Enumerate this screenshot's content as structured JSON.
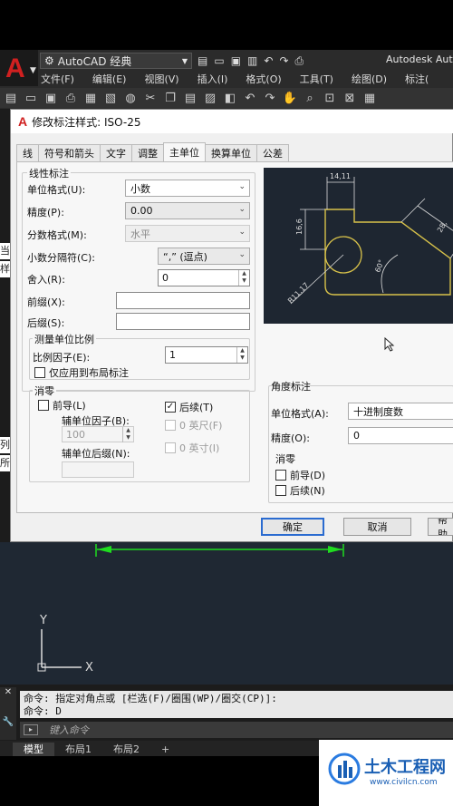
{
  "app": {
    "workspace": "AutoCAD 经典",
    "title": "Autodesk Aut",
    "menu": [
      "文件(F)",
      "编辑(E)",
      "视图(V)",
      "插入(I)",
      "格式(O)",
      "工具(T)",
      "绘图(D)",
      "标注("
    ],
    "side_fragments": [
      "当",
      "样",
      "列",
      "所"
    ]
  },
  "dialog": {
    "title": "修改标注样式: ISO-25",
    "tabs": [
      "线",
      "符号和箭头",
      "文字",
      "调整",
      "主单位",
      "换算单位",
      "公差"
    ],
    "active_tab": "主单位",
    "linear": {
      "group": "线性标注",
      "unit_format_label": "单位格式(U):",
      "unit_format_value": "小数",
      "precision_label": "精度(P):",
      "precision_value": "0.00",
      "fraction_format_label": "分数格式(M):",
      "fraction_format_value": "水平",
      "decimal_sep_label": "小数分隔符(C):",
      "decimal_sep_value": "“,” (逗点)",
      "round_off_label": "舍入(R):",
      "round_off_value": "0",
      "prefix_label": "前缀(X):",
      "prefix_value": "",
      "suffix_label": "后缀(S):",
      "suffix_value": ""
    },
    "scale": {
      "group": "测量单位比例",
      "factor_label": "比例因子(E):",
      "factor_value": "1",
      "layout_only_label": "仅应用到布局标注"
    },
    "zero_suppress": {
      "group": "消零",
      "leading_label": "前导(L)",
      "trailing_label": "后续(T)",
      "sub_factor_label": "辅单位因子(B):",
      "sub_factor_value": "100",
      "sub_suffix_label": "辅单位后缀(N):",
      "sub_suffix_value": "",
      "feet_label": "0 英尺(F)",
      "inches_label": "0 英寸(I)"
    },
    "angular": {
      "group": "角度标注",
      "unit_format_label": "单位格式(A):",
      "unit_format_value": "十进制度数",
      "precision_label": "精度(O):",
      "precision_value": "0",
      "zero_group": "消零",
      "leading_label": "前导(D)",
      "trailing_label": "后续(N)"
    },
    "preview": {
      "dim_top": "14,11",
      "dim_left": "16,6",
      "dim_right": "28,",
      "dim_angle": "60°",
      "dim_radius": "R11,17"
    },
    "buttons": {
      "ok": "确定",
      "cancel": "取消",
      "help": "帮助"
    }
  },
  "command": {
    "history_line1": "命令: 指定对角点或 [栏选(F)/圈围(WP)/圈交(CP)]:",
    "history_line2": "命令: D",
    "input_placeholder": "键入命令"
  },
  "layout_tabs": [
    "模型",
    "布局1",
    "布局2",
    "+"
  ],
  "ucs": {
    "x": "X",
    "y": "Y"
  },
  "watermark": {
    "title": "土木工程网",
    "url": "www.civilcn.com"
  },
  "colors": {
    "accent": "#d02020",
    "dim_green": "#1fdc1f",
    "preview_yellow": "#d8c24a"
  }
}
